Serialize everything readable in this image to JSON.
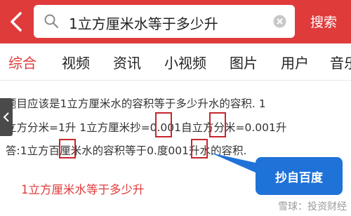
{
  "search": {
    "value": "1立方厘米水等于多少升",
    "button_label": "搜索"
  },
  "tabs": [
    {
      "label": "综合",
      "active": true
    },
    {
      "label": "视频",
      "active": false
    },
    {
      "label": "资讯",
      "active": false
    },
    {
      "label": "小视频",
      "active": false
    },
    {
      "label": "图片",
      "active": false
    },
    {
      "label": "用户",
      "active": false
    },
    {
      "label": "音乐",
      "active": false
    }
  ],
  "answer_lines": [
    "题目应该是1立方厘米水的容积等于多少升水的容积. 1",
    "立方分米=1升 1立方厘米抄=0.001自立方分米=0.001升",
    "答:1立方百厘米水的容积等于0.度001升水的容积."
  ],
  "result_title": "1立方厘米水等于多少升",
  "callout_label": "抄自百度",
  "watermark": "雪球：投资财经",
  "colors": {
    "brand_red": "#e03b3b",
    "highlight_box": "#c6262e",
    "callout_blue": "#1f72d8"
  },
  "icons": {
    "back": "back-arrow-icon",
    "search": "search-icon",
    "clear": "clear-icon",
    "side": "chevron-left-icon"
  }
}
